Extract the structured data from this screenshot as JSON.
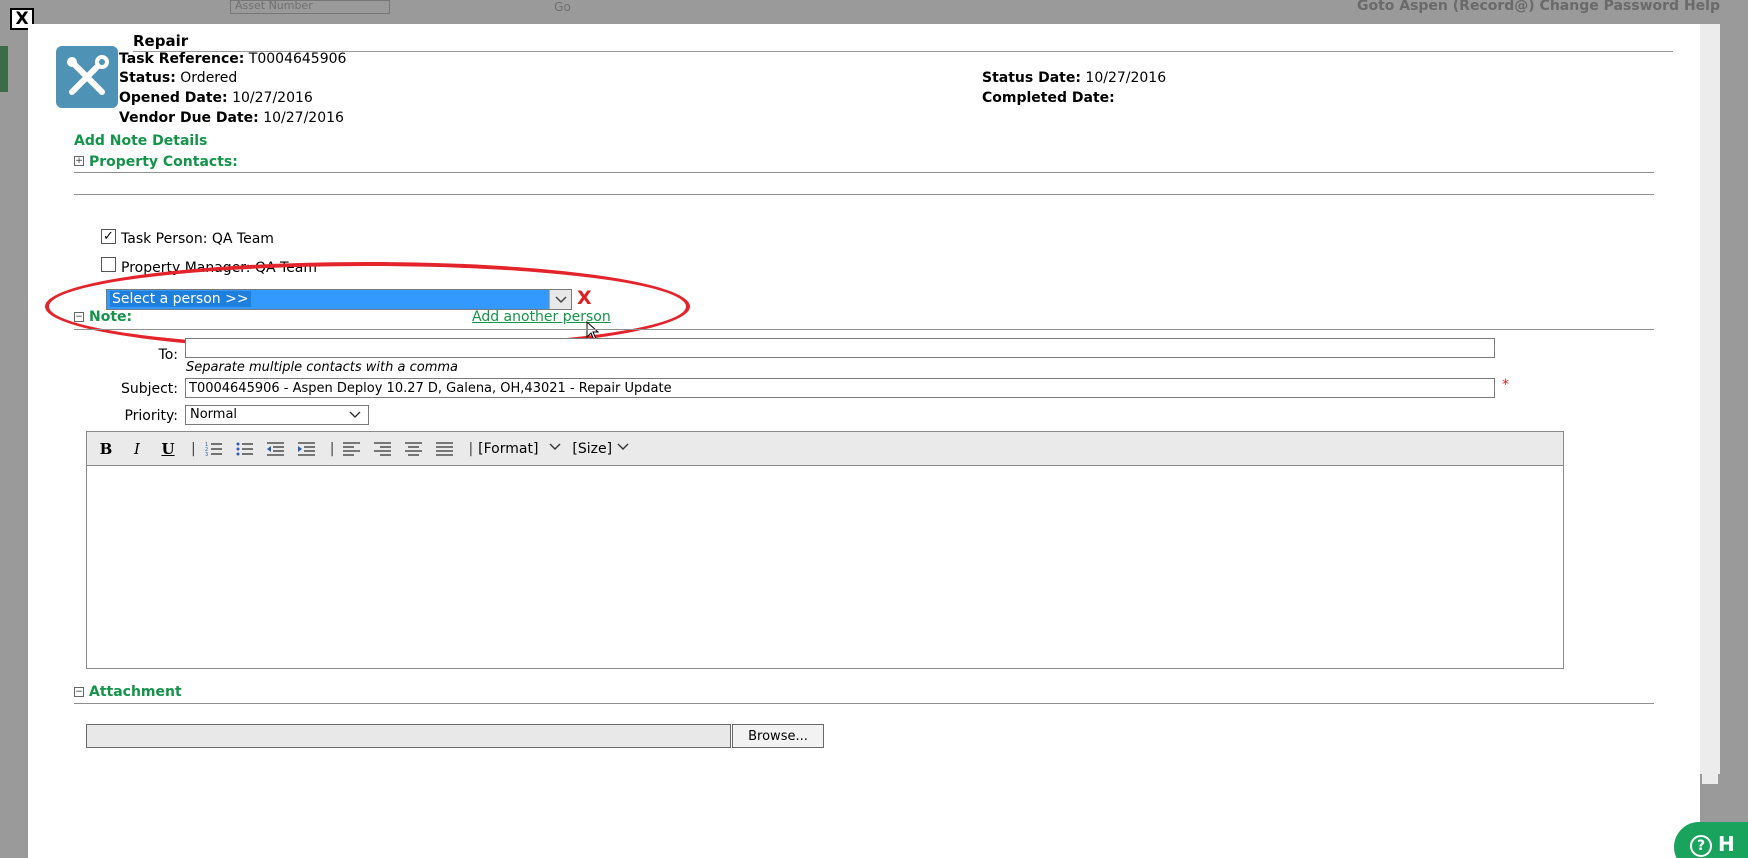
{
  "background": {
    "top_select": "Asset Number",
    "go_label": "Go",
    "top_right_links": "Goto Aspen (Record@)  Change Password  Help"
  },
  "modal": {
    "close_label": "X",
    "task": {
      "type": "Repair",
      "reference_label": "Task Reference:",
      "reference_value": "T0004645906",
      "status_label": "Status:",
      "status_value": "Ordered",
      "opened_label": "Opened Date:",
      "opened_value": "10/27/2016",
      "vendor_due_label": "Vendor Due Date:",
      "vendor_due_value": "10/27/2016",
      "status_date_label": "Status Date:",
      "status_date_value": "10/27/2016",
      "completed_label": "Completed Date:",
      "completed_value": ""
    },
    "add_note_title": "Add Note Details",
    "property_contacts": {
      "title": "Property Contacts:",
      "toggle": "+",
      "contacts": [
        {
          "label": "Task Person: QA Team",
          "checked": true
        },
        {
          "label": "Property Manager: QA Team",
          "checked": false
        }
      ],
      "person_select": "Select a person >>",
      "remove_label": "X",
      "add_another": "Add another person"
    },
    "note": {
      "title": "Note:",
      "toggle": "−",
      "to_label": "To:",
      "to_value": "",
      "to_hint": "Separate multiple contacts with a comma",
      "subject_label": "Subject:",
      "subject_value": "T0004645906 - Aspen Deploy 10.27 D, Galena, OH,43021 - Repair Update",
      "required_mark": "*",
      "priority_label": "Priority:",
      "priority_value": "Normal"
    },
    "editor": {
      "bold": "B",
      "italic": "I",
      "underline": "U",
      "separator": "|",
      "format_label": "[Format]",
      "size_label": "[Size]",
      "content": ""
    },
    "attachment": {
      "title": "Attachment",
      "toggle": "−",
      "browse_label": "Browse..."
    }
  },
  "help": {
    "label": "H"
  },
  "colors": {
    "accent_green": "#14944a",
    "highlight_red": "#e3242b",
    "icon_blue": "#4e93b5",
    "selection_blue": "#3399ff"
  }
}
